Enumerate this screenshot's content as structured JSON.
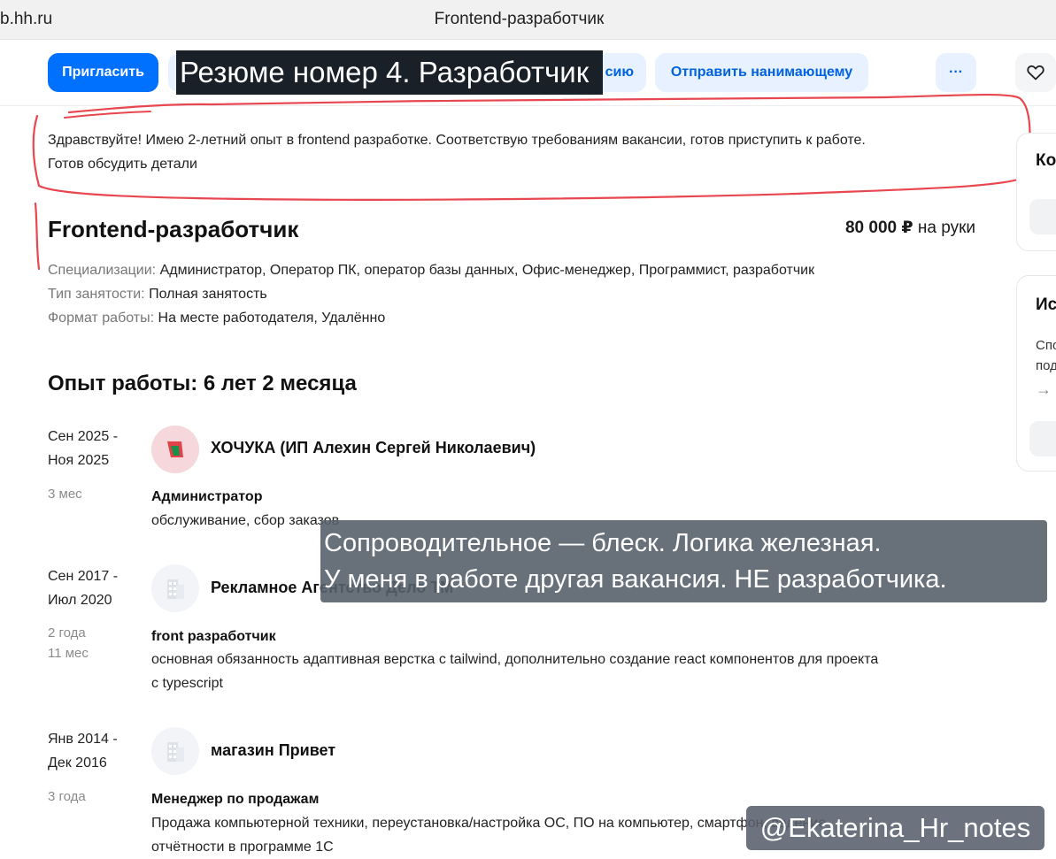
{
  "browser": {
    "url": "b.hh.ru",
    "title": "Frontend-разработчик"
  },
  "toolbar": {
    "invite_label": "Пригласить",
    "hidden_btn_label": "сию",
    "send_label": "Отправить нанимающему",
    "more_label": "···",
    "heart_icon": "heart-icon"
  },
  "overlays": {
    "top_caption": "Резюме номер 4. Разработчик",
    "comment_line1": "Сопроводительное — блеск. Логика железная.",
    "comment_line2": "У меня в работе другая вакансия. НЕ разработчика.",
    "watermark": "@Ekaterina_Hr_notes"
  },
  "cover_letter": {
    "line1": "Здравствуйте! Имею 2-летний опыт в frontend разработке. Соответствую требованиям вакансии, готов приступить к работе.",
    "line2": "Готов обсудить детали"
  },
  "vacancy": {
    "title": "Frontend-разработчик",
    "salary_amount": "80 000 ₽",
    "salary_suffix": "на руки",
    "spec_label": "Специализации:",
    "spec_value": "Администратор, Оператор ПК, оператор базы данных, Офис-менеджер, Программист, разработчик",
    "employment_label": "Тип занятости:",
    "employment_value": "Полная занятость",
    "format_label": "Формат работы:",
    "format_value": "На месте работодателя, Удалённо"
  },
  "experience": {
    "title": "Опыт работы: 6 лет 2 месяца",
    "jobs": [
      {
        "date_from": "Сен 2025 -",
        "date_to": "Ноя 2025",
        "duration1": "3 мес",
        "duration2": "",
        "company": "ХОЧУКА (ИП Алехин Сергей Николаевич)",
        "role": "Администратор",
        "desc1": "обслуживание, сбор заказов",
        "desc2": ""
      },
      {
        "date_from": "Сен 2017 -",
        "date_to": "Июл 2020",
        "duration1": "2 года",
        "duration2": "11 мес",
        "company": "Рекламное Агентство Дело ТМ",
        "role": "front разработчик",
        "desc1": "основная обязанность адаптивная верстка с tailwind, дополнительно создание react компонентов для проекта",
        "desc2": "с typescript"
      },
      {
        "date_from": "Янв 2014 -",
        "date_to": "Дек 2016",
        "duration1": "3 года",
        "duration2": "",
        "company": "магазин Привет",
        "role": "Менеджер по продажам",
        "desc1": "Продажа компьютерной техники, переустановка/настройка ОС, ПО на компьютер, смартфон, ведение",
        "desc2": "отчётности в программе 1С"
      }
    ]
  },
  "sidebar": {
    "card1_heading": "Ко",
    "card2_heading": "Ис",
    "card2_text1": "Спо",
    "card2_text2": "под",
    "arrow_icon": "arrow-right-icon"
  },
  "colors": {
    "accent": "#0070ff",
    "accent_light": "#e8f1ff",
    "annotation_red": "#e8474f"
  }
}
